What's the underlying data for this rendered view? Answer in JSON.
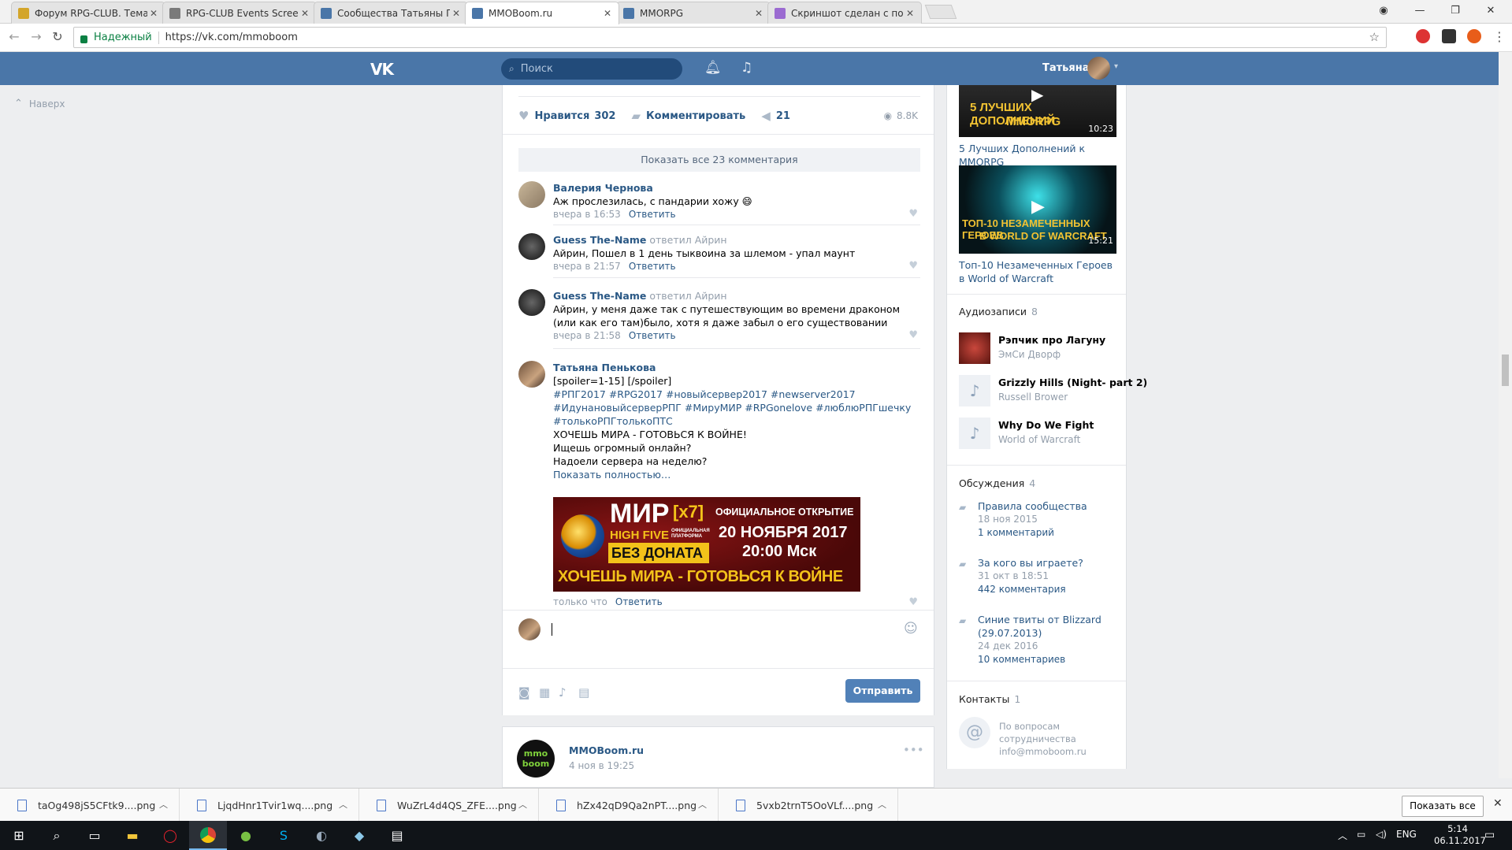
{
  "browser": {
    "tabs": [
      {
        "title": "Форум RPG-CLUB. Тема",
        "fav": "#d3a52a",
        "active": false
      },
      {
        "title": "RPG-CLUB Events Screen",
        "fav": "#7a7a7a",
        "active": false
      },
      {
        "title": "Сообщества Татьяны Пе",
        "fav": "#4a76a8",
        "active": false
      },
      {
        "title": "MMOBoom.ru",
        "fav": "#4a76a8",
        "active": true
      },
      {
        "title": "MMORPG",
        "fav": "#4a76a8",
        "active": false
      },
      {
        "title": "Скриншот сделан с пом",
        "fav": "#9b6bd1",
        "active": false
      }
    ],
    "tab_close": "✕",
    "secure_label": "Надежный",
    "url": "https://vk.com/mmoboom"
  },
  "vk": {
    "logo": "VK",
    "search_placeholder": "Поиск",
    "user_name": "Татьяна",
    "back_to_top": "Наверх"
  },
  "post": {
    "like_label": "Нравится",
    "like_count": "302",
    "comment_label": "Комментировать",
    "share_count": "21",
    "views": "8.8K",
    "show_all_comments": "Показать все 23 комментария",
    "reply_label": "Ответить",
    "comments": [
      {
        "author": "Валерия Чернова",
        "replied": "",
        "text": "Аж прослезилась, с пандарии хожу 😄",
        "time": "вчера в 16:53"
      },
      {
        "author": "Guess The-Name",
        "replied": "ответил Айрин",
        "text": "Айрин, Пошел в 1 день тыквоина за шлемом - упал маунт",
        "time": "вчера в 21:57"
      },
      {
        "author": "Guess The-Name",
        "replied": "ответил Айрин",
        "text": "Айрин, у меня даже так с путешествующим во времени драконом (или как его там)было, хотя я даже забыл о его существовании",
        "time": "вчера в 21:58"
      }
    ],
    "own_comment": {
      "author": "Татьяна Пенькова",
      "line1": "[spoiler=1-15] [/spoiler]",
      "tags1": "#РПГ2017 #RPG2017 #новыйсервер2017 #newserver2017",
      "tags2": "#ИдунановыйсерверРПГ #МируМИР #RPGonelove #люблюРПГшечку",
      "tags3": "#толькоРПГтолькоПТС",
      "line2": "ХОЧЕШЬ МИРА - ГОТОВЬСЯ К ВОЙНЕ!",
      "line3": "Ищешь огромный онлайн?",
      "line4": "Надоели сервера на неделю?",
      "more": "Показать полностью…",
      "time": "только что"
    },
    "banner": {
      "mir": "МИР",
      "x7": "[x7]",
      "official": "ОФИЦИАЛЬНОЕ ОТКРЫТИЕ",
      "highfive": "HIGH FIVE",
      "platform": "ОФИЦИАЛЬНАЯ ПЛАТФОРМА",
      "date": "20 НОЯБРЯ 2017",
      "nodonate": "БЕЗ ДОНАТА",
      "time": "20:00 Мск",
      "slogan": "ХОЧЕШЬ МИРА - ГОТОВЬСЯ К ВОЙНЕ"
    },
    "send_label": "Отправить"
  },
  "post2": {
    "author": "MMOBoom.ru",
    "date": "4 ноя в 19:25",
    "logo_text": "mmo boom"
  },
  "sidebar": {
    "videos": [
      {
        "thumb_text1": "5 ЛУЧШИХ ДОПОЛНЕНИЙ",
        "thumb_text2": "MMORPG",
        "duration": "10:23",
        "title": "5 Лучших Дополнений к MMORPG"
      },
      {
        "thumb_text1": "ТОП-10 НЕЗАМЕЧЕННЫХ ГЕРОЕВ",
        "thumb_text2": "В WORLD OF WARCRAFT",
        "duration": "15:21",
        "title": "Топ-10 Незамеченных Героев в World of Warcraft"
      }
    ],
    "audio_title": "Аудиозаписи",
    "audio_count": "8",
    "audios": [
      {
        "title": "Рэпчик про Лагуну",
        "artist": "ЭмСи Дворф"
      },
      {
        "title": "Grizzly Hills (Night- part 2)",
        "artist": "Russell Brower"
      },
      {
        "title": "Why Do We Fight",
        "artist": "World of Warcraft"
      }
    ],
    "disc_title": "Обсуждения",
    "disc_count": "4",
    "discussions": [
      {
        "title": "Правила сообщества",
        "date": "18 ноя 2015",
        "count": "1 комментарий"
      },
      {
        "title": "За кого вы играете?",
        "date": "31 окт в 18:51",
        "count": "442 комментария"
      },
      {
        "title": "Синие твиты от Blizzard (29.07.2013)",
        "date": "24 дек 2016",
        "count": "10 комментариев"
      }
    ],
    "contacts_title": "Контакты",
    "contacts_count": "1",
    "contact_line1": "По вопросам",
    "contact_line2": "сотрудничества",
    "contact_email": "info@mmoboom.ru"
  },
  "downloads": {
    "files": [
      "taOg498jS5CFtk9....png",
      "LjqdHnr1Tvir1wq....png",
      "WuZrL4d4QS_ZFE....png",
      "hZx42qD9Qa2nPT....png",
      "5vxb2trnT5OoVLf....png"
    ],
    "show_all": "Показать все"
  },
  "taskbar": {
    "lang": "ENG",
    "time": "5:14",
    "date": "06.11.2017"
  }
}
